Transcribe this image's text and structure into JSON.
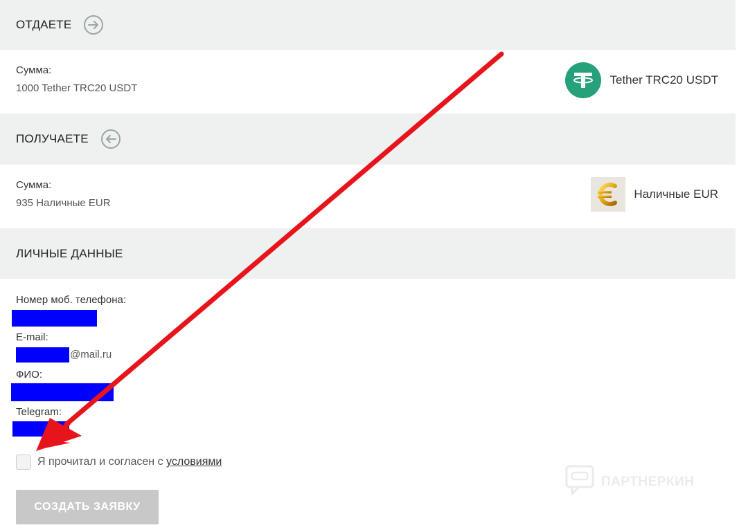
{
  "give": {
    "title": "ОТДАЕТЕ",
    "amount_label": "Сумма:",
    "amount_value": "1000 Tether TRC20 USDT",
    "currency_name": "Tether TRC20 USDT",
    "icon": "arrow-right-icon",
    "logo": "tether-logo"
  },
  "receive": {
    "title": "ПОЛУЧАЕТЕ",
    "amount_label": "Сумма:",
    "amount_value": "935 Наличные EUR",
    "currency_name": "Наличные EUR",
    "icon": "arrow-left-icon",
    "logo": "euro-logo"
  },
  "personal": {
    "title": "ЛИЧНЫЕ ДАННЫЕ",
    "phone_label": "Номер моб. телефона:",
    "email_label": "E-mail:",
    "email_suffix": "@mail.ru",
    "name_label": "ФИО:",
    "telegram_label": "Telegram:"
  },
  "agreement": {
    "text": "Я прочитал и согласен с ",
    "link": "условиями",
    "checked": false
  },
  "submit": {
    "label": "СОЗДАТЬ ЗАЯВКУ"
  },
  "watermark": {
    "text": "ПАРТНЕРКИН"
  },
  "colors": {
    "header_bg": "#eef1f0",
    "tether_green": "#26a17b",
    "redaction": "#0000ff",
    "annotation_arrow": "#e8141c",
    "button_disabled": "#c8c8c8"
  }
}
